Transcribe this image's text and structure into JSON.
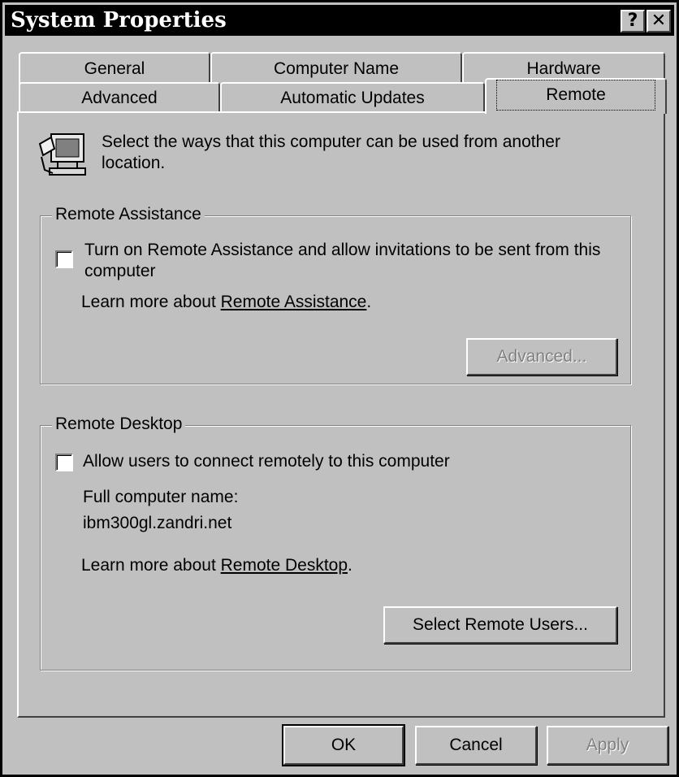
{
  "window": {
    "title": "System Properties",
    "help_glyph": "?",
    "close_glyph": "✕"
  },
  "tabs": {
    "row_back": [
      "General",
      "Computer Name",
      "Hardware"
    ],
    "row_front": [
      "Advanced",
      "Automatic Updates",
      "Remote"
    ],
    "active": "Remote"
  },
  "intro": {
    "icon": "remote-computers-icon",
    "line1": "Select the ways that this computer can be used from another",
    "line2": "location."
  },
  "remote_assistance": {
    "legend": "Remote Assistance",
    "checkbox_line1": "Turn on Remote Assistance and allow invitations to be sent from this",
    "checkbox_line2": "computer",
    "checked": false,
    "learn_prefix": "Learn more about ",
    "learn_link": "Remote Assistance",
    "learn_suffix": ".",
    "advanced_button": "Advanced..."
  },
  "remote_desktop": {
    "legend": "Remote Desktop",
    "checkbox_label": "Allow users to connect remotely to this computer",
    "checked": false,
    "computer_name_label": "Full computer name:",
    "computer_name_value": "ibm300gl.zandri.net",
    "learn_prefix": "Learn more about ",
    "learn_link": "Remote Desktop",
    "learn_suffix": ".",
    "select_users_button": "Select Remote Users..."
  },
  "footer": {
    "ok": "OK",
    "cancel": "Cancel",
    "apply": "Apply"
  }
}
